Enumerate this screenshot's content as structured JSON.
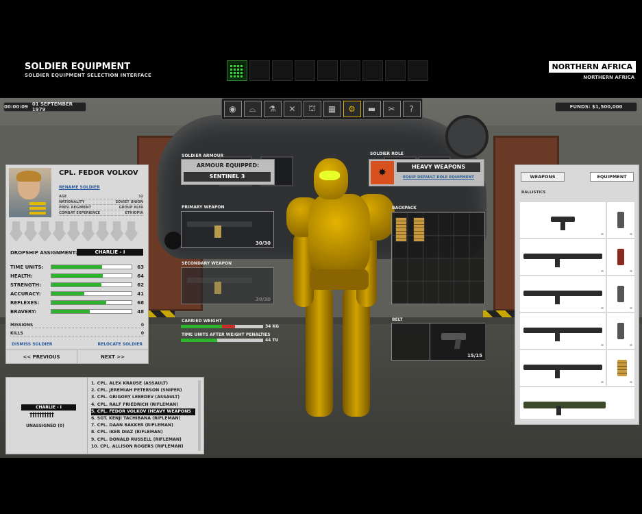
{
  "header": {
    "title": "SOLDIER EQUIPMENT",
    "subtitle": "SOLDIER EQUIPMENT SELECTION INTERFACE",
    "region": "NORTHERN AFRICA",
    "region_sub": "NORTHERN AFRICA"
  },
  "status": {
    "time": "00:00:09",
    "date": "01 SEPTEMBER 1979",
    "funds": "FUNDS: $1,500,000"
  },
  "toolbar_icons": [
    "globe-icon",
    "hangar-icon",
    "lab-icon",
    "workshop-icon",
    "base-icon",
    "stores-icon",
    "equipment-icon",
    "vehicle-icon",
    "personnel-icon",
    "help-icon"
  ],
  "soldier": {
    "name": "CPL. FEDOR VOLKOV",
    "rename_label": "RENAME SOLDIER",
    "info": [
      {
        "label": "AGE",
        "value": "32"
      },
      {
        "label": "NATIONALITY",
        "value": "SOVIET UNION"
      },
      {
        "label": "PREV. REGIMENT",
        "value": "GROUP ALFA"
      },
      {
        "label": "COMBAT EXPERIENCE",
        "value": "ETHIOPIA"
      }
    ],
    "dropship_label": "DROPSHIP ASSIGNMENT:",
    "dropship_value": "CHARLIE - I",
    "stats": [
      {
        "label": "TIME UNITS:",
        "value": "63",
        "pct": 0.63
      },
      {
        "label": "HEALTH:",
        "value": "64",
        "pct": 0.64
      },
      {
        "label": "STRENGTH:",
        "value": "62",
        "pct": 0.62
      },
      {
        "label": "ACCURACY:",
        "value": "41",
        "pct": 0.41
      },
      {
        "label": "REFLEXES:",
        "value": "68",
        "pct": 0.68
      },
      {
        "label": "BRAVERY:",
        "value": "48",
        "pct": 0.48
      }
    ],
    "missions_label": "MISSIONS",
    "missions_value": "0",
    "kills_label": "KILLS",
    "kills_value": "0",
    "dismiss_label": "DISMISS SOLDIER",
    "relocate_label": "RELOCATE SOLDIER",
    "prev_label": "<< PREVIOUS",
    "next_label": "NEXT >>"
  },
  "squad": {
    "tag": "CHARLIE - I",
    "men": "††††††††††",
    "unassigned": "UNASSIGNED (0)",
    "roster": [
      "1.   CPL. ALEX KRAUSE (ASSAULT)",
      "2.   CPL. JEREMIAH PETERSON (SNIPER)",
      "3.   CPL. GRIGORY LEBEDEV (ASSAULT)",
      "4.   CPL. RALF FRIEDRICH (RIFLEMAN)",
      "5.   CPL. FEDOR VOLKOV (HEAVY WEAPONS",
      "6.   SGT. KENJI TACHIBANA (RIFLEMAN)",
      "7.   CPL. DAAN BAKKER (RIFLEMAN)",
      "8.   CPL. IKER DIAZ (RIFLEMAN)",
      "9.   CPL. DONALD RUSSELL (RIFLEMAN)",
      "10.  CPL. ALLISON ROGERS (RIFLEMAN)"
    ],
    "selected_index": 4
  },
  "loadout": {
    "armour_label": "SOLDIER ARMOUR",
    "armour_title": "ARMOUR EQUIPPED:",
    "armour_value": "SENTINEL 3",
    "primary_label": "PRIMARY WEAPON",
    "primary_ammo": "30/30",
    "secondary_label": "SECONDARY WEAPON",
    "secondary_ammo": "30/30",
    "carried_label": "CARRIED WEIGHT",
    "carried_value": "34 KG",
    "carried_fill": 0.5,
    "carried_over": 0.16,
    "tu_label": "TIME UNITS AFTER WEIGHT PENALTIES",
    "tu_value": "44 TU",
    "tu_fill": 0.44,
    "role_label": "SOLDIER ROLE",
    "role_name": "HEAVY WEAPONS",
    "role_link": "EQUIP DEFAULT ROLE EQUIPMENT",
    "backpack_label": "BACKPACK",
    "belt_label": "BELT",
    "belt_ammo": "15/15"
  },
  "equipment": {
    "tab_weapons": "WEAPONS",
    "tab_equipment": "EQUIPMENT",
    "category": "BALLISTICS",
    "items": [
      {
        "weapon": "pistol-icon",
        "ammo": "pistol-magazine-icon",
        "qty": "∞",
        "ammo_qty": "∞"
      },
      {
        "weapon": "shotgun-icon",
        "ammo": "shotgun-shells-icon",
        "qty": "∞",
        "ammo_qty": "∞"
      },
      {
        "weapon": "assault-rifle-icon",
        "ammo": "rifle-magazine-icon",
        "qty": "∞",
        "ammo_qty": "∞"
      },
      {
        "weapon": "sniper-rifle-icon",
        "ammo": "sniper-magazine-icon",
        "qty": "∞",
        "ammo_qty": "∞"
      },
      {
        "weapon": "machine-gun-icon",
        "ammo": "ammo-belt-icon",
        "qty": "∞",
        "ammo_qty": "∞"
      },
      {
        "weapon": "rocket-launcher-icon",
        "ammo": "",
        "qty": "",
        "ammo_qty": ""
      }
    ]
  },
  "colors": {
    "stat_bar": "#2cb52c",
    "accent": "#d4b100",
    "overweight": "#d12b2b",
    "role_icon_bg": "#d7501e"
  }
}
